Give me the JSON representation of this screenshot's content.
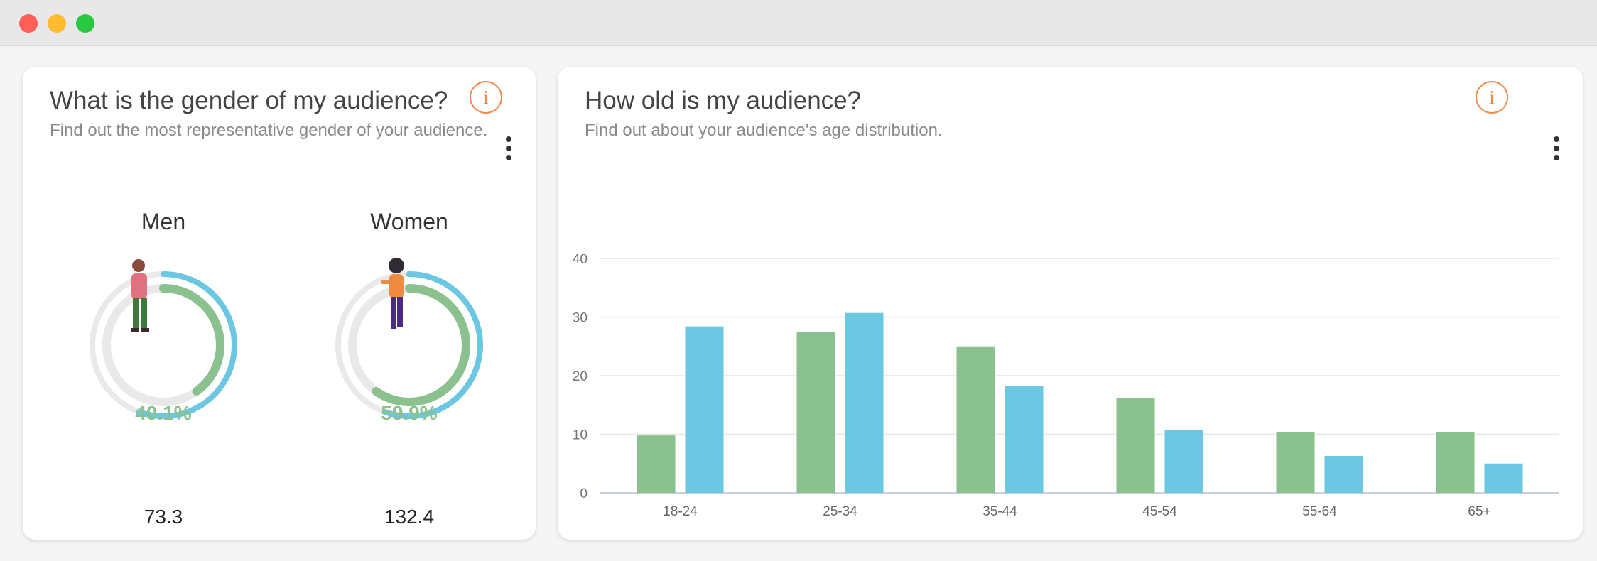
{
  "gender_card": {
    "title": "What is the gender of my audience?",
    "subtitle": "Find out the most representative gender of your audience.",
    "info_icon": "i",
    "men": {
      "label": "Men",
      "percent_text": "40.1%",
      "percent": 40.1,
      "value": "73.3"
    },
    "women": {
      "label": "Women",
      "percent_text": "59.9%",
      "percent": 59.9,
      "value": "132.4"
    }
  },
  "age_card": {
    "title": "How old is my audience?",
    "subtitle": "Find out about your audience's age distribution.",
    "info_icon": "i"
  },
  "colors": {
    "men_series": "#8bc18f",
    "women_series": "#6cc7e2",
    "accent": "#f08a4b",
    "track": "#e9e9e9"
  },
  "chart_data": {
    "type": "bar",
    "categories": [
      "18-24",
      "25-34",
      "35-44",
      "45-54",
      "55-64",
      "65+"
    ],
    "series": [
      {
        "values": [
          9.8,
          27.4,
          25.0,
          16.2,
          10.4,
          10.4
        ]
      },
      {
        "values": [
          28.4,
          30.7,
          18.3,
          10.7,
          6.3,
          5.0
        ]
      }
    ],
    "yticks": [
      0,
      10,
      20,
      30,
      40
    ],
    "ylim": [
      0,
      40
    ],
    "grid": true,
    "legend": "none"
  }
}
